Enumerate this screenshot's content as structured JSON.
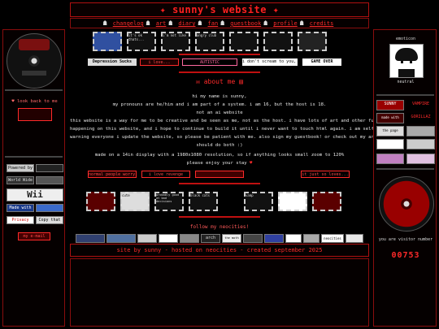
{
  "header": {
    "title": "sunny's website"
  },
  "nav": {
    "items": [
      "changelog",
      "art",
      "diary",
      "fan",
      "guestbook",
      "profile",
      "credits"
    ]
  },
  "left": {
    "back_label": "look back to me",
    "buttons": [
      "Powered by",
      "World Wide Web",
      "Wii",
      "Made with My Computer",
      "Privacy Now!",
      "Copy that Floppy!"
    ],
    "email_label": "my e-mail"
  },
  "main": {
    "stamps_top": [
      "",
      "it's ok thats...",
      "i'm not like",
      "angry club",
      "",
      "",
      ""
    ],
    "banners": [
      "Depression Sucks",
      "i love...",
      "AUTISTIC",
      "i don't scream to you, ugh",
      "GAME OVER"
    ],
    "about_title": "about me",
    "about_lines": [
      "hi my name is sunny,",
      "my pronouns are he/him and i am part of a system. i am 16, but the host is 18.",
      "not an ai website",
      "this website is a way for me to be creative and be seen as me, not as the host. i have lots of art and other fun things",
      "happening on this website, and i hope to continue to build it until i never want to touch html again. i am self taught, and a4",
      "warning everyone i update the website, so please be patient with me. also sign my guestbook! or check out my art, or both; you",
      "should do both :)",
      "made on a 14in display with a 1980x1080 resolution, so if anything looks small zoom to 120%",
      "please enjoy your stay"
    ],
    "mid_banners": [
      "normal people worry me",
      "i love revenge",
      "",
      "it just so loves..."
    ],
    "stamps_bottom": [
      "",
      "cute",
      "probably good at bad decisions",
      "black cats",
      "vamp",
      "",
      ""
    ],
    "follow_label": "follow my neocities!",
    "buttons88": [
      "",
      "",
      "",
      "",
      "",
      "arch",
      "the moth girl",
      "",
      "",
      "",
      "",
      "neocities",
      ""
    ]
  },
  "footer": {
    "text": "site by sunny - hosted on neocities - created september 2025"
  },
  "right": {
    "emoticon_label": "emoticon",
    "char_label": "neutral",
    "buttons": [
      "SUNNY",
      "VAMPIRE",
      "made with love",
      "GORILLAZ",
      "the page",
      "",
      "",
      "",
      ""
    ],
    "visitor_label": "you are visitor number",
    "visitor_count": "00753"
  },
  "colors": {
    "accent": "#ff2a2a",
    "border": "#8a0d0d",
    "bg": "#000000"
  }
}
